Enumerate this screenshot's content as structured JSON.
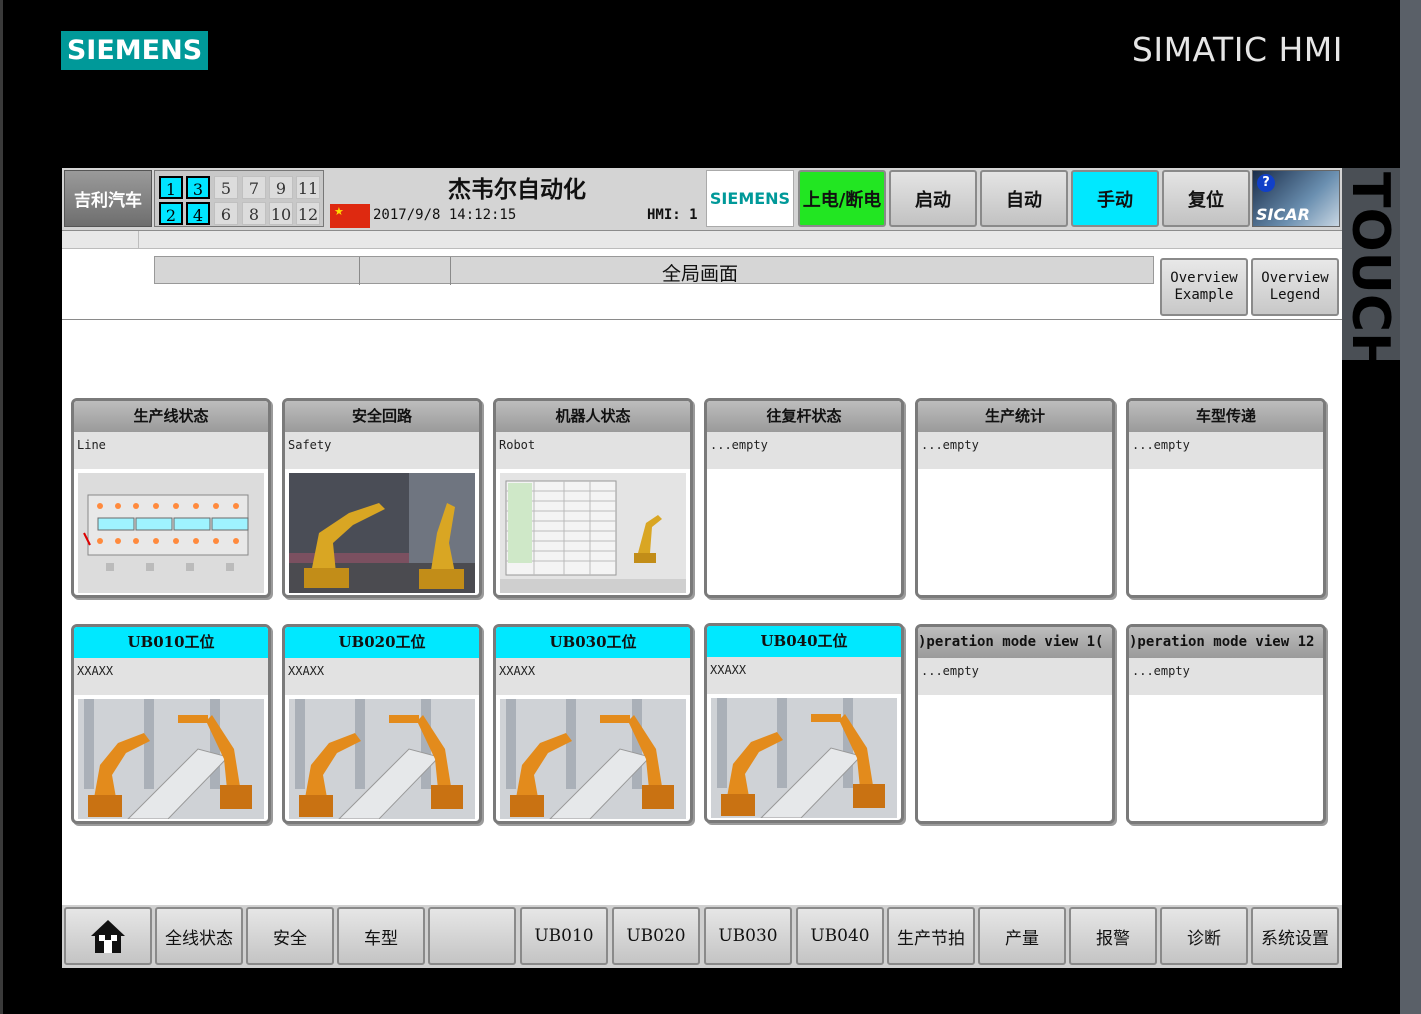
{
  "bezel": {
    "logo": "SIEMENS",
    "product": "SIMATIC HMI",
    "touch": "TOUCH"
  },
  "header": {
    "company_logo": "吉利汽车",
    "stations_on": [
      "1",
      "3",
      "2",
      "4"
    ],
    "stations_off": [
      "5",
      "7",
      "9",
      "11",
      "6",
      "8",
      "10",
      "12"
    ],
    "title": "杰韦尔自动化",
    "datetime": "2017/9/8 14:12:15",
    "hmi": "HMI: 1",
    "siemens_logo": "SIEMENS",
    "buttons": {
      "power": "上电/断电",
      "start": "启动",
      "auto": "自动",
      "manual": "手动",
      "reset": "复位"
    },
    "sicar": "SICAR",
    "help": "?"
  },
  "screen_title": "全局画面",
  "overview_example": [
    "Overview",
    "Example"
  ],
  "overview_legend": [
    "Overview",
    "Legend"
  ],
  "cards_row1": [
    {
      "title": "生产线状态",
      "desc": "Line"
    },
    {
      "title": "安全回路",
      "desc": "Safety"
    },
    {
      "title": "机器人状态",
      "desc": "Robot"
    },
    {
      "title": "往复杆状态",
      "desc": "...empty"
    },
    {
      "title": "生产统计",
      "desc": "...empty"
    },
    {
      "title": "车型传递",
      "desc": "...empty"
    }
  ],
  "cards_row2": [
    {
      "title": "UB010工位",
      "desc": "XXAXX"
    },
    {
      "title": "UB020工位",
      "desc": "XXAXX"
    },
    {
      "title": "UB030工位",
      "desc": "XXAXX"
    },
    {
      "title": "UB040工位",
      "desc": "XXAXX"
    },
    {
      "title": ")peration mode view 1(",
      "desc": "...empty"
    },
    {
      "title": ")peration mode view 12",
      "desc": "...empty"
    }
  ],
  "nav": [
    "全线状态",
    "安全",
    "车型",
    "",
    "UB010",
    "UB020",
    "UB030",
    "UB040",
    "生产节拍",
    "产量",
    "报警",
    "诊断",
    "系统设置"
  ],
  "colors": {
    "accent_cyan": "#00e8ff",
    "power_green": "#22e622",
    "siemens_teal": "#009999"
  }
}
